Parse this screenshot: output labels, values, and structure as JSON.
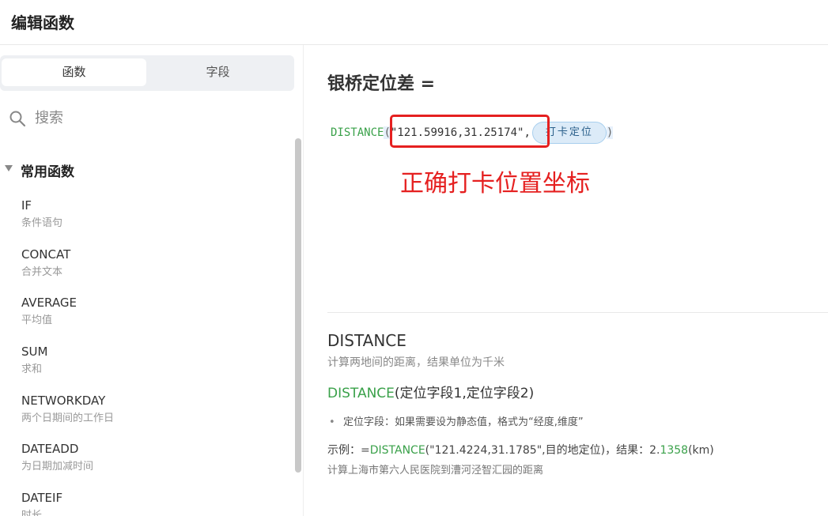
{
  "header": {
    "title": "编辑函数"
  },
  "sidebar": {
    "tabs": [
      {
        "label": "函数"
      },
      {
        "label": "字段"
      }
    ],
    "search": {
      "placeholder": "搜索"
    },
    "group": {
      "label": "常用函数"
    },
    "functions": [
      {
        "name": "IF",
        "desc": "条件语句"
      },
      {
        "name": "CONCAT",
        "desc": "合并文本"
      },
      {
        "name": "AVERAGE",
        "desc": "平均值"
      },
      {
        "name": "SUM",
        "desc": "求和"
      },
      {
        "name": "NETWORKDAY",
        "desc": "两个日期间的工作日"
      },
      {
        "name": "DATEADD",
        "desc": "为日期加减时间"
      },
      {
        "name": "DATEIF",
        "desc": "时长"
      }
    ]
  },
  "editor": {
    "title": "银桥定位差 =",
    "formula": {
      "function": "DISTANCE",
      "open_paren": "(",
      "string_arg": "\"121.59916,31.25174\",",
      "field_pill": "打卡定位",
      "close_paren": ")"
    },
    "annotation": "正确打卡位置坐标",
    "annotation_color": "#e52020"
  },
  "doc": {
    "name": "DISTANCE",
    "description": "计算两地间的距离，结果单位为千米",
    "syntax_fn": "DISTANCE",
    "syntax_args": "(定位字段1,定位字段2)",
    "bullet": "定位字段：如果需要设为静态值，格式为“经度,维度”",
    "example_prefix": "示例：=",
    "example_fn": "DISTANCE",
    "example_mid": "(\"121.4224,31.1785\",目的地定位)，结果：2.",
    "example_num": "1358",
    "example_suffix": "(km)",
    "note": "计算上海市第六人民医院到漕河泾智汇园的距离"
  },
  "colors": {
    "function_green": "#3aa14a",
    "pill_blue": "#dcebf8"
  }
}
